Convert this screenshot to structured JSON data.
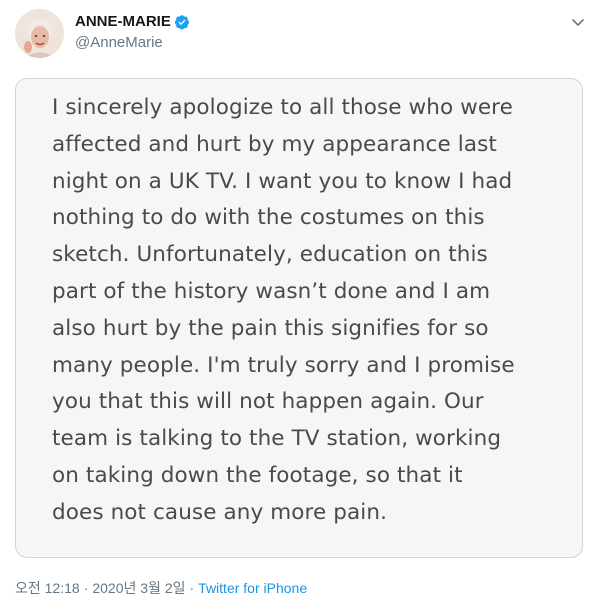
{
  "author": {
    "display_name": "ANNE-MARIE",
    "handle": "@AnneMarie",
    "verified_icon": "verified-badge-icon"
  },
  "tweet": {
    "image_text": "I sincerely apologize to all those who were\naffected and hurt by my appearance last\nnight on a UK TV. I want you to know I had\nnothing to do with the costumes on this\nsketch. Unfortunately, education on this\npart of the history wasn’t done and I am\nalso hurt by the pain this signifies for so\nmany people. I'm truly sorry and I promise\nyou that this will not happen again. Our\nteam is talking to the TV station, working\non taking down the footage, so that it\ndoes not cause any more pain."
  },
  "meta": {
    "time": "오전 12:18",
    "separator": "·",
    "date": "2020년 3월 2일",
    "source": "Twitter for iPhone"
  },
  "colors": {
    "accent": "#1da1f2",
    "link": "#1b95e0",
    "secondary_text": "#657786"
  }
}
